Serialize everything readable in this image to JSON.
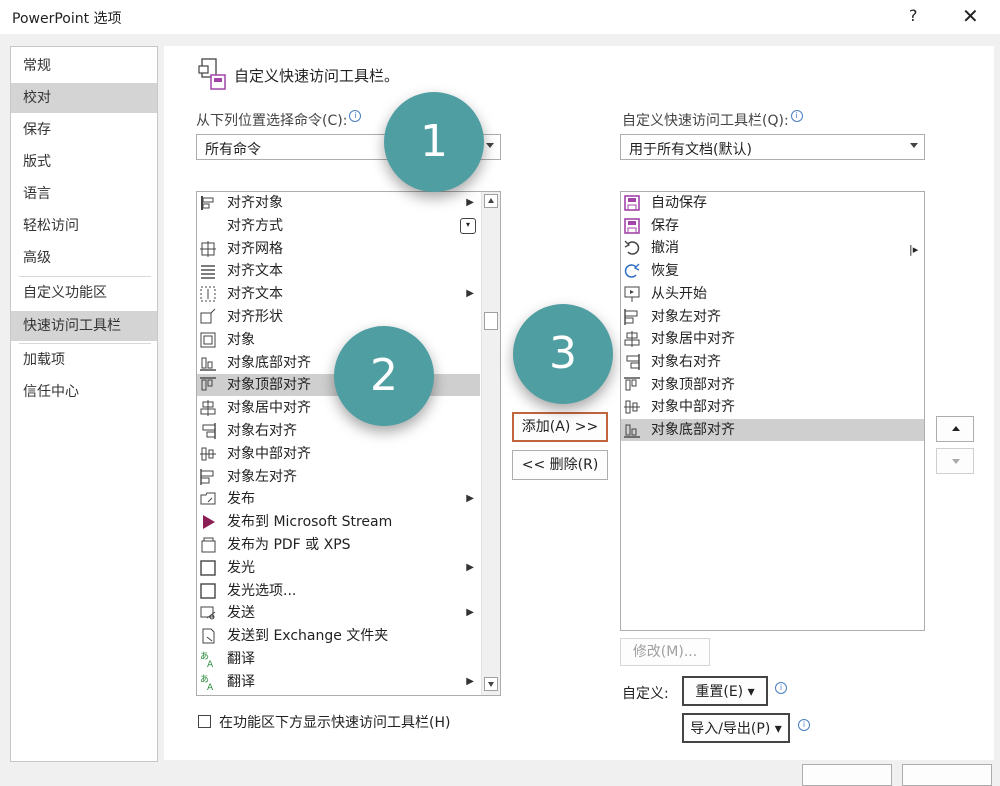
{
  "window": {
    "title": "PowerPoint 选项",
    "help": "?",
    "close": "✕"
  },
  "nav": {
    "items": [
      {
        "label": "常规"
      },
      {
        "label": "校对"
      },
      {
        "label": "保存"
      },
      {
        "label": "版式"
      },
      {
        "label": "语言"
      },
      {
        "label": "轻松访问"
      },
      {
        "label": "高级"
      },
      {
        "label": "自定义功能区"
      },
      {
        "label": "快速访问工具栏"
      },
      {
        "label": "加载项"
      },
      {
        "label": "信任中心"
      }
    ],
    "selected": [
      "校对",
      "快速访问工具栏"
    ]
  },
  "header": {
    "title": "自定义快速访问工具栏。"
  },
  "left": {
    "label": "从下列位置选择命令(C):",
    "combo_value": "所有命令",
    "commands": [
      {
        "label": "对齐对象",
        "icon": "align-icon",
        "submenu": true
      },
      {
        "label": "对齐方式",
        "icon": "",
        "dropdown": true
      },
      {
        "label": "对齐网格",
        "icon": "grid-icon"
      },
      {
        "label": "对齐文本",
        "icon": "text-lines-icon"
      },
      {
        "label": "对齐文本",
        "icon": "text-align-icon",
        "submenu": true
      },
      {
        "label": "对齐形状",
        "icon": "shape-icon"
      },
      {
        "label": "对象",
        "icon": "object-icon"
      },
      {
        "label": "对象底部对齐",
        "icon": "align-bottom-icon"
      },
      {
        "label": "对象顶部对齐",
        "icon": "align-top-icon",
        "selected": true
      },
      {
        "label": "对象居中对齐",
        "icon": "align-center-icon"
      },
      {
        "label": "对象右对齐",
        "icon": "align-right-icon"
      },
      {
        "label": "对象中部对齐",
        "icon": "align-middle-icon"
      },
      {
        "label": "对象左对齐",
        "icon": "align-left-icon"
      },
      {
        "label": "发布",
        "icon": "publish-icon",
        "submenu": true
      },
      {
        "label": "发布到 Microsoft Stream",
        "icon": "stream-icon"
      },
      {
        "label": "发布为 PDF 或 XPS",
        "icon": "pdf-icon"
      },
      {
        "label": "发光",
        "icon": "glow-icon",
        "submenu": true
      },
      {
        "label": "发光选项...",
        "icon": "glow-options-icon"
      },
      {
        "label": "发送",
        "icon": "send-icon",
        "submenu": true
      },
      {
        "label": "发送到 Exchange 文件夹",
        "icon": "exchange-icon"
      },
      {
        "label": "翻译",
        "icon": "translate-icon"
      },
      {
        "label": "翻译",
        "icon": "translate-icon",
        "submenu": true
      }
    ]
  },
  "middle": {
    "add": "添加(A) >>",
    "remove": "<< 删除(R)"
  },
  "right": {
    "label": "自定义快速访问工具栏(Q):",
    "combo_value": "用于所有文档(默认)",
    "items": [
      {
        "label": "自动保存",
        "icon": "autosave-icon"
      },
      {
        "label": "保存",
        "icon": "save-icon"
      },
      {
        "label": "撤消",
        "icon": "undo-icon",
        "separator_marker": true
      },
      {
        "label": "恢复",
        "icon": "redo-icon"
      },
      {
        "label": "从头开始",
        "icon": "slideshow-icon"
      },
      {
        "label": "对象左对齐",
        "icon": "align-left-icon"
      },
      {
        "label": "对象居中对齐",
        "icon": "align-center-icon"
      },
      {
        "label": "对象右对齐",
        "icon": "align-right-icon"
      },
      {
        "label": "对象顶部对齐",
        "icon": "align-top-icon"
      },
      {
        "label": "对象中部对齐",
        "icon": "align-middle-icon"
      },
      {
        "label": "对象底部对齐",
        "icon": "align-bottom-icon",
        "selected": true
      }
    ],
    "modify": "修改(M)...",
    "customize_label": "自定义:",
    "reset": "重置(E) ▾",
    "import_export": "导入/导出(P) ▾"
  },
  "footer": {
    "checkbox_label": "在功能区下方显示快速访问工具栏(H)"
  },
  "callouts": [
    "1",
    "2",
    "3"
  ],
  "colors": {
    "callout": "#4f9ea1",
    "add_button_border": "#c0653c",
    "save_icon": "#a244a8",
    "selection": "#cfcfcf"
  }
}
